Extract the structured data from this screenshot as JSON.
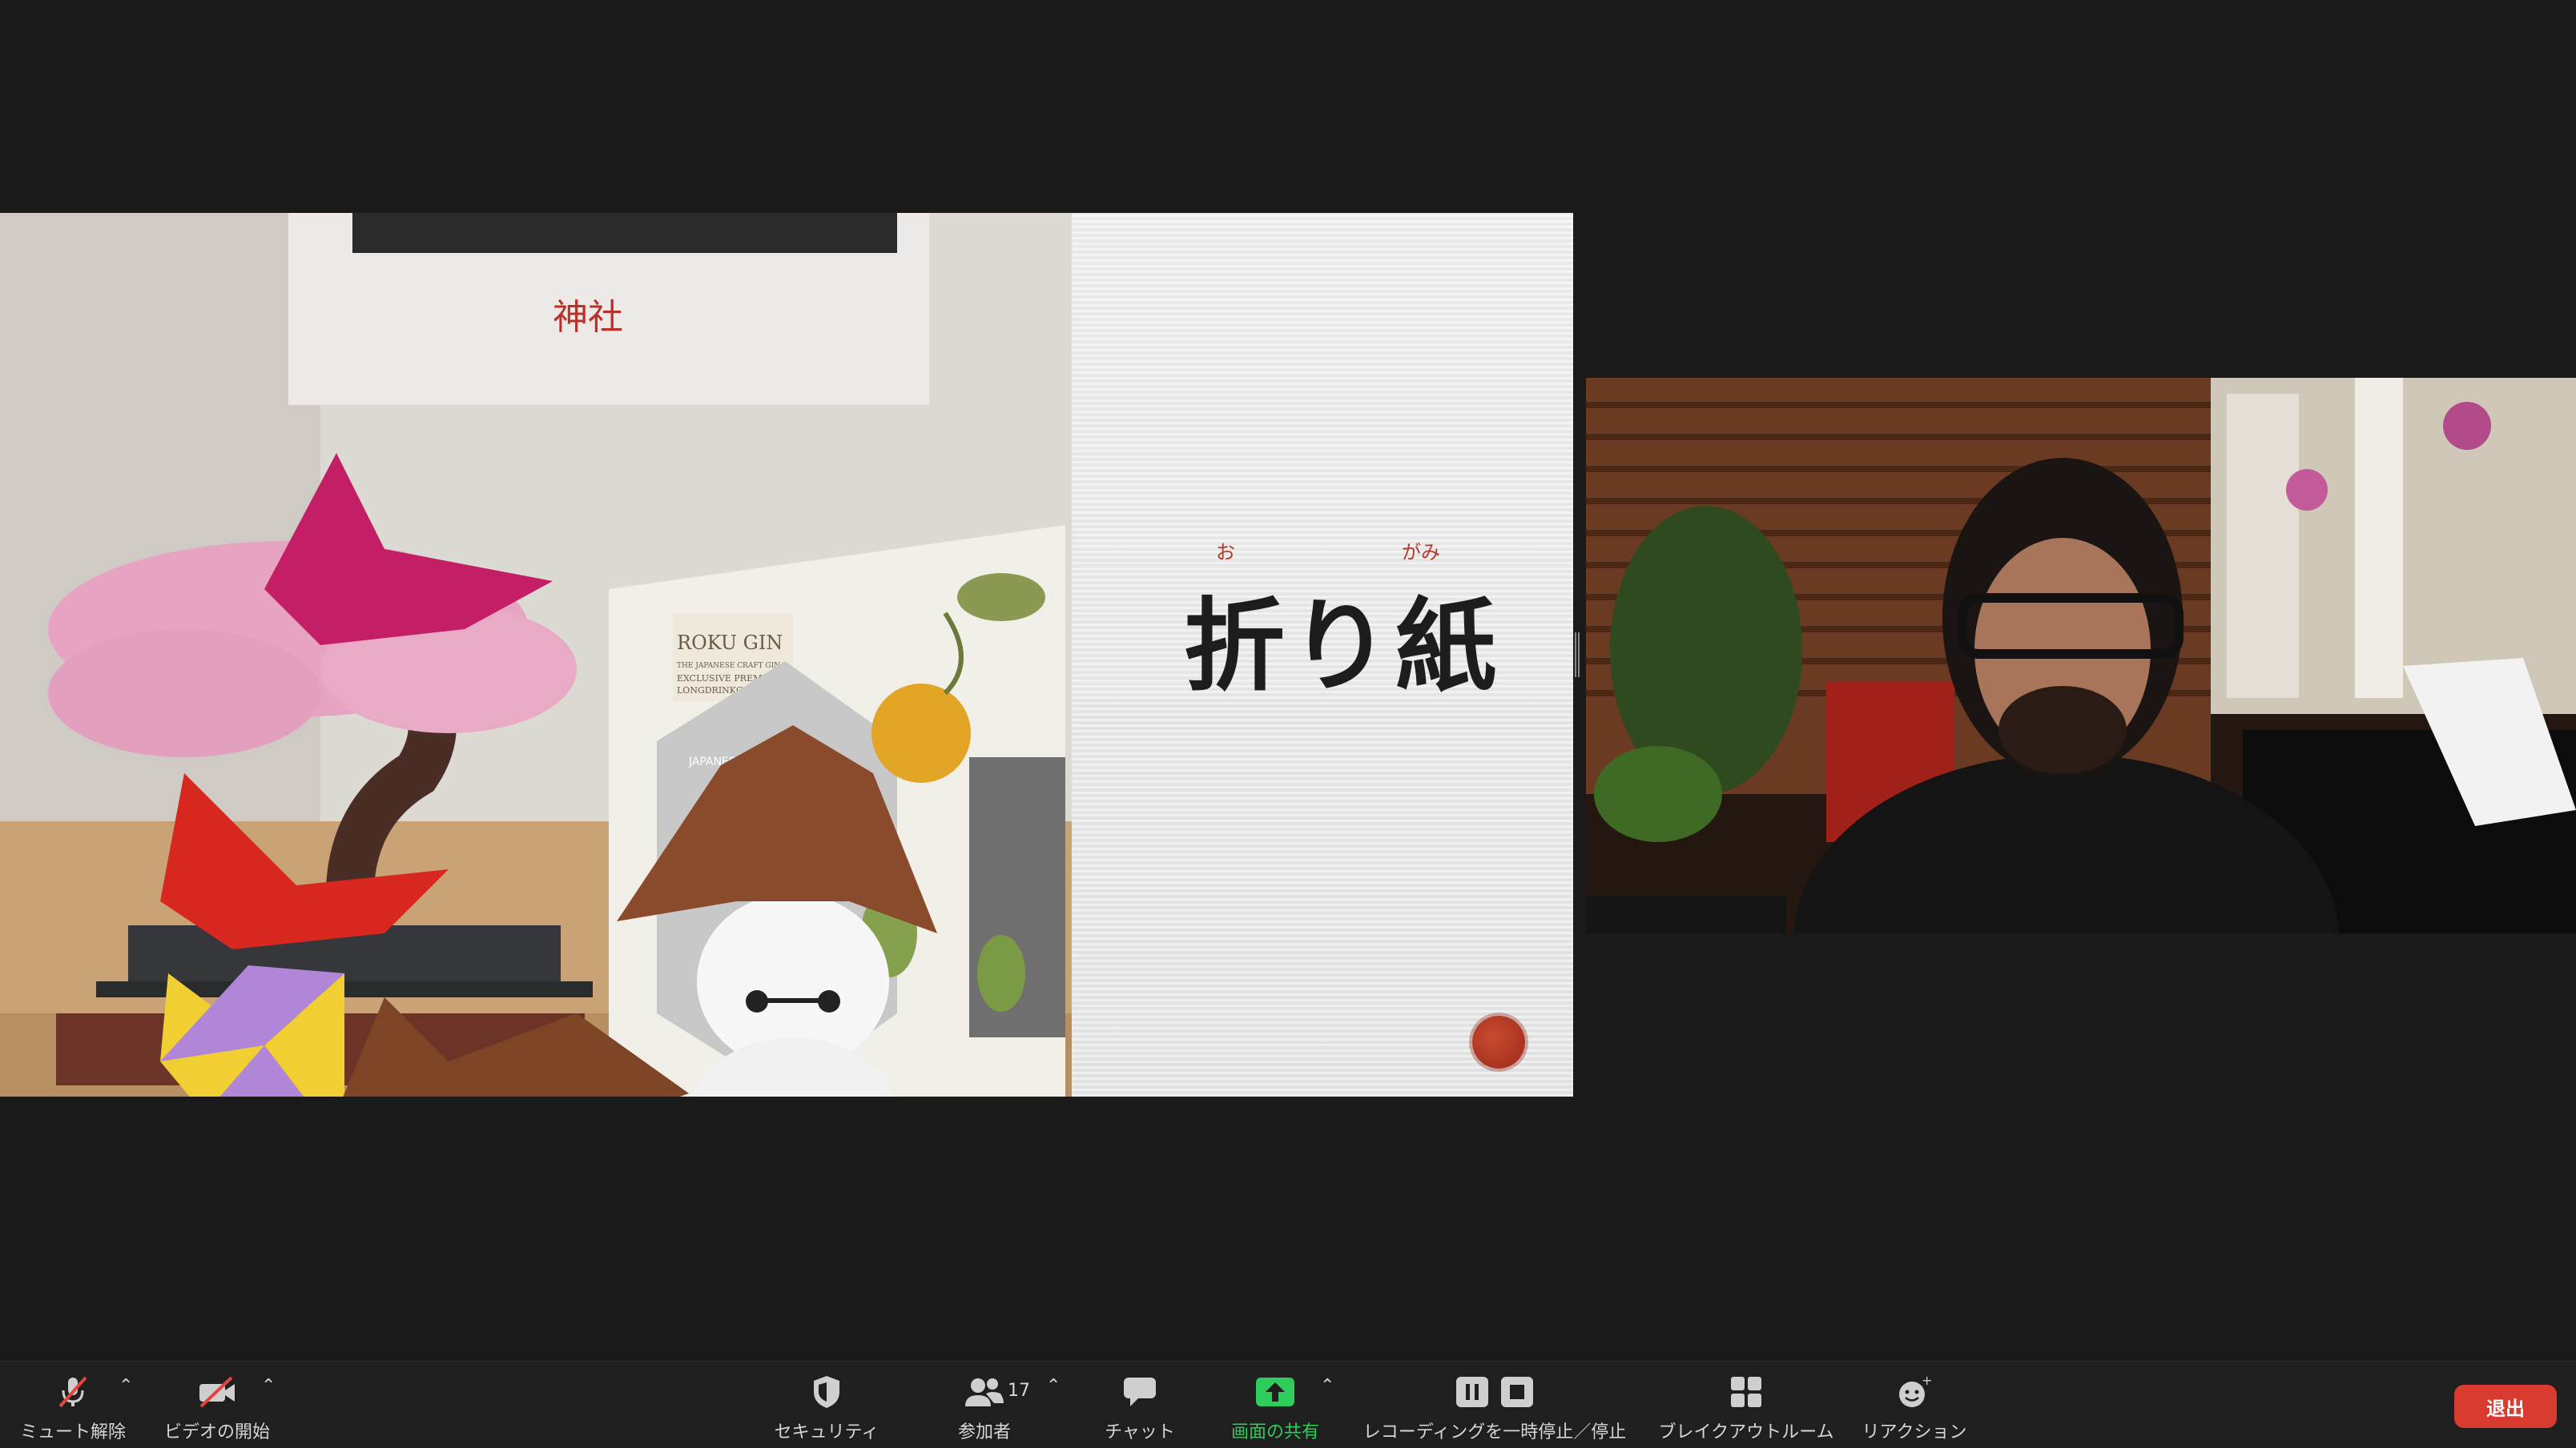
{
  "slide": {
    "photo_texts": {
      "shrine": "神社",
      "gin_brand": "ROKU GIN",
      "gin_tagline": "THE JAPANESE CRAFT GIN",
      "gin_line1": "EXCLUSIVE PREMIUM",
      "gin_line2": "LONGDRINKGLAS",
      "gin_box_label": "JAPANESE CRAFT"
    },
    "furigana_o": "お",
    "furigana_gami": "がみ",
    "title": "折り紙"
  },
  "toolbar": {
    "mute_label": "ミュート解除",
    "video_label": "ビデオの開始",
    "security_label": "セキュリティ",
    "participants_label": "参加者",
    "participants_count": "17",
    "chat_label": "チャット",
    "share_label": "画面の共有",
    "recording_label": "レコーディングを一時停止／停止",
    "breakout_label": "ブレイクアウトルーム",
    "reactions_label": "リアクション",
    "leave_label": "退出"
  },
  "colors": {
    "background": "#1a1a1a",
    "toolbar": "#1f1f1f",
    "share_green": "#2ecc5a",
    "leave_red": "#d93b30",
    "muted_slash": "#e0463b",
    "slide_red": "#b23a2a"
  }
}
